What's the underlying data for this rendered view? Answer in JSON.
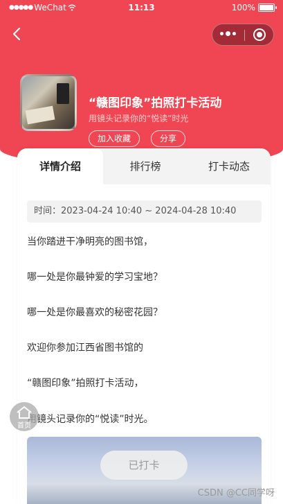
{
  "status_bar": {
    "carrier": "WeChat",
    "time": "11:13",
    "battery": "100%",
    "battery_level": 1.0
  },
  "nav": {
    "back_icon": "chevron-left-icon",
    "more_icon": "more-dots-icon",
    "close_icon": "target-circle-icon"
  },
  "activity": {
    "title": "“赣图印象”拍照打卡活动",
    "subtitle": "用镜头记录你的“悦读”时光",
    "favorite_label": "加入收藏",
    "share_label": "分享"
  },
  "tabs": [
    {
      "label": "详情介绍",
      "active": true
    },
    {
      "label": "排行榜",
      "active": false
    },
    {
      "label": "打卡动态",
      "active": false
    }
  ],
  "detail": {
    "time_text": "时间：2023-04-24 10:40 ~ 2024-04-28 10:40",
    "paragraphs": [
      "当你踏进干净明亮的图书馆，",
      "哪一处是你最钟爱的学习宝地？",
      "哪一处是你最喜欢的秘密花园？",
      "欢迎你参加江西省图书馆的",
      "“赣图印象”拍照打卡活动，",
      "用镜头记录你的“悦读”时光。"
    ],
    "checked_label": "已打卡"
  },
  "home_fab": {
    "label": "首页",
    "icon": "home-icon"
  },
  "watermark": "CSDN @CC同学呀",
  "colors": {
    "brand": "#f04552",
    "capsule": "#a32b37"
  }
}
